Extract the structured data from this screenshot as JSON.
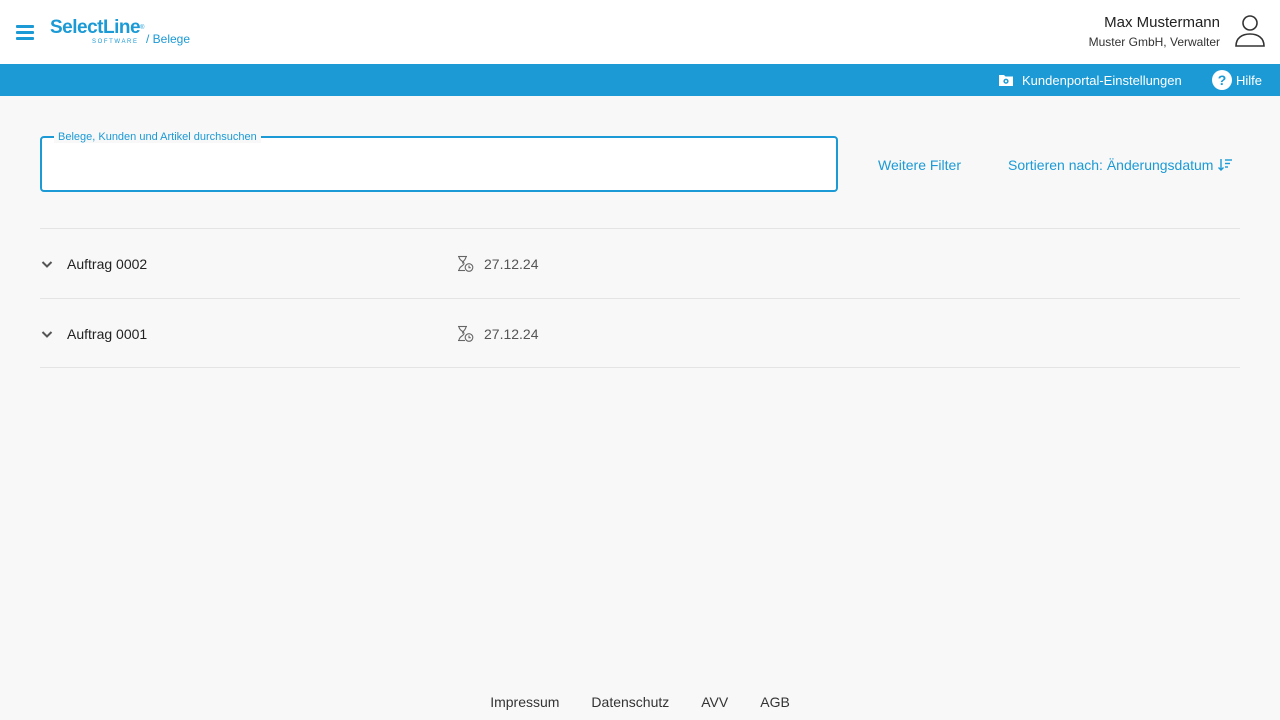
{
  "header": {
    "logo_text": "SelectLine",
    "logo_sub": "SOFTWARE",
    "breadcrumb": "/ Belege",
    "user_name": "Max Mustermann",
    "user_org": "Muster GmbH, Verwalter"
  },
  "toolbar": {
    "settings_label": "Kundenportal-Einstellungen",
    "help_label": "Hilfe",
    "help_symbol": "?"
  },
  "search": {
    "label": "Belege, Kunden und Artikel durchsuchen",
    "value": ""
  },
  "filters": {
    "more_filters_label": "Weitere Filter",
    "sort_label": "Sortieren nach: Änderungsdatum"
  },
  "documents": [
    {
      "title": "Auftrag 0002",
      "date": "27.12.24",
      "status_icon": "hourglass-clock-icon"
    },
    {
      "title": "Auftrag 0001",
      "date": "27.12.24",
      "status_icon": "hourglass-clock-icon"
    }
  ],
  "footer": {
    "links": [
      "Impressum",
      "Datenschutz",
      "AVV",
      "AGB"
    ]
  },
  "colors": {
    "brand": "#1b9ad6",
    "background": "#f8f8f8",
    "header_bg": "#ffffff"
  }
}
